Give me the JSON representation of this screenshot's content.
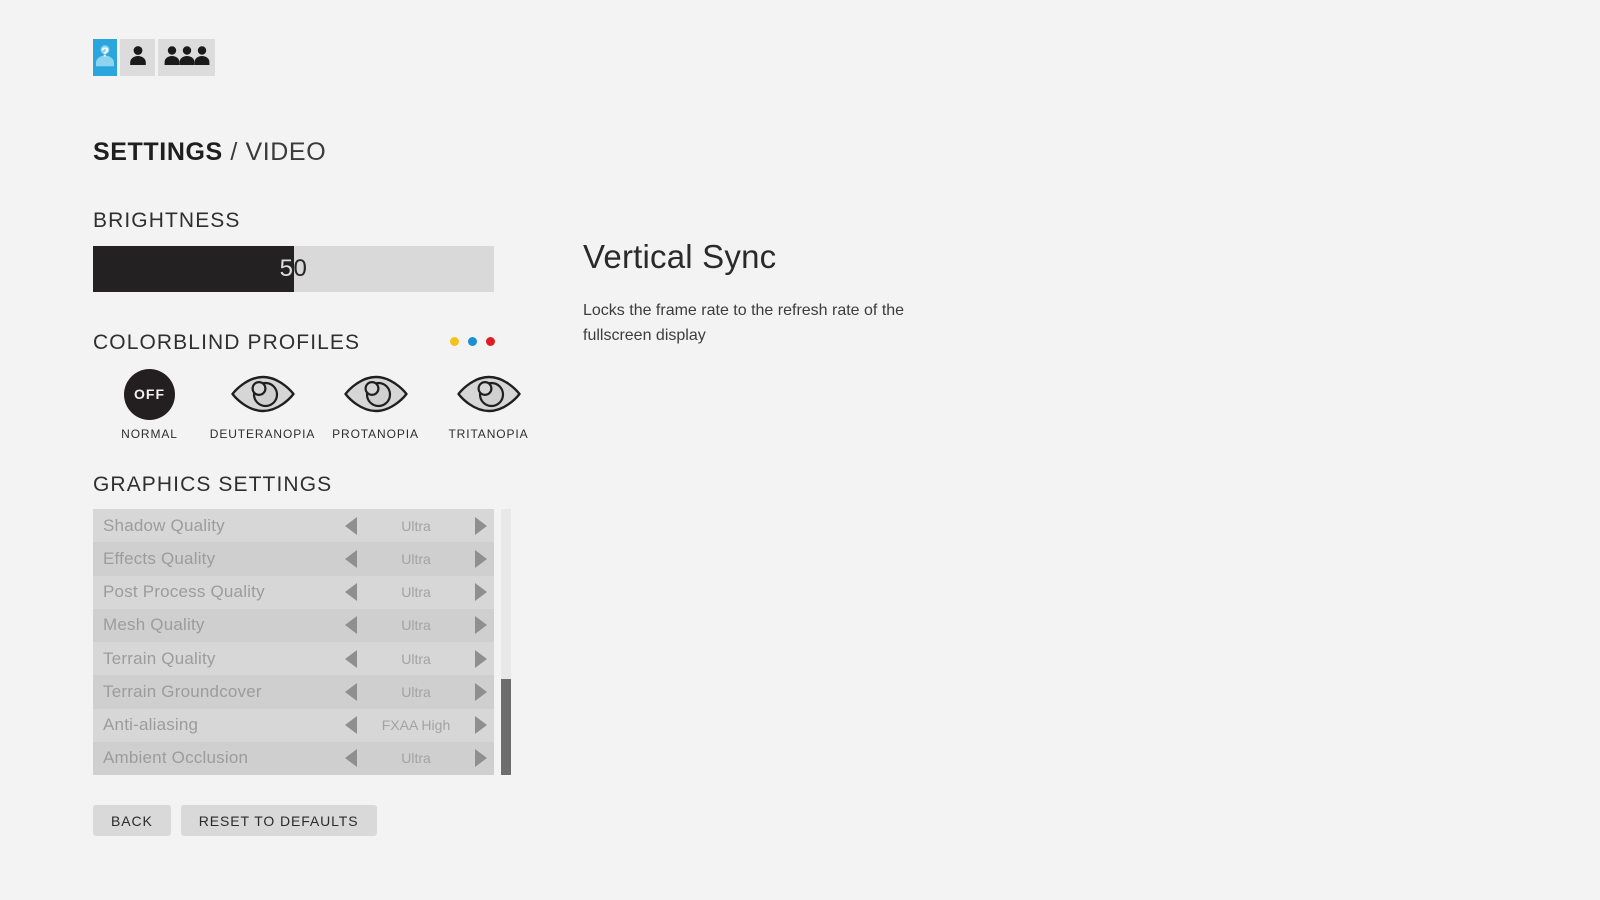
{
  "tabs": [
    {
      "name": "profile-unknown-tab",
      "icon": "person-question-icon",
      "active": true
    },
    {
      "name": "profile-single-tab",
      "icon": "person-icon",
      "active": false
    },
    {
      "name": "profile-group-tab",
      "icon": "people-group-icon",
      "active": false
    }
  ],
  "header": {
    "title_strong": "SETTINGS",
    "title_light": " / VIDEO"
  },
  "brightness": {
    "heading": "BRIGHTNESS",
    "value": "50",
    "fill_percent": 50
  },
  "colorblind": {
    "heading": "COLORBLIND PROFILES",
    "dots": [
      "#f2c319",
      "#1b8fd4",
      "#e01b22"
    ],
    "options": [
      {
        "label": "NORMAL",
        "badge": "OFF",
        "icon": "off-circle",
        "selected": true
      },
      {
        "label": "DEUTERANOPIA",
        "badge": "",
        "icon": "eye-icon",
        "selected": false
      },
      {
        "label": "PROTANOPIA",
        "badge": "",
        "icon": "eye-icon",
        "selected": false
      },
      {
        "label": "TRITANOPIA",
        "badge": "",
        "icon": "eye-icon",
        "selected": false
      }
    ]
  },
  "graphics": {
    "heading": "GRAPHICS SETTINGS",
    "rows": [
      {
        "name": "Shadow Quality",
        "value": "Ultra"
      },
      {
        "name": "Effects Quality",
        "value": "Ultra"
      },
      {
        "name": "Post Process Quality",
        "value": "Ultra"
      },
      {
        "name": "Mesh Quality",
        "value": "Ultra"
      },
      {
        "name": "Terrain Quality",
        "value": "Ultra"
      },
      {
        "name": "Terrain Groundcover",
        "value": "Ultra"
      },
      {
        "name": "Anti-aliasing",
        "value": "FXAA High"
      },
      {
        "name": "Ambient Occlusion",
        "value": "Ultra"
      }
    ],
    "scroll_thumb_top_percent": 64,
    "scroll_thumb_height_percent": 36
  },
  "buttons": {
    "back": "BACK",
    "reset": "RESET TO DEFAULTS"
  },
  "detail": {
    "title": "Vertical Sync",
    "description": "Locks the frame rate to the refresh rate of the fullscreen display"
  }
}
